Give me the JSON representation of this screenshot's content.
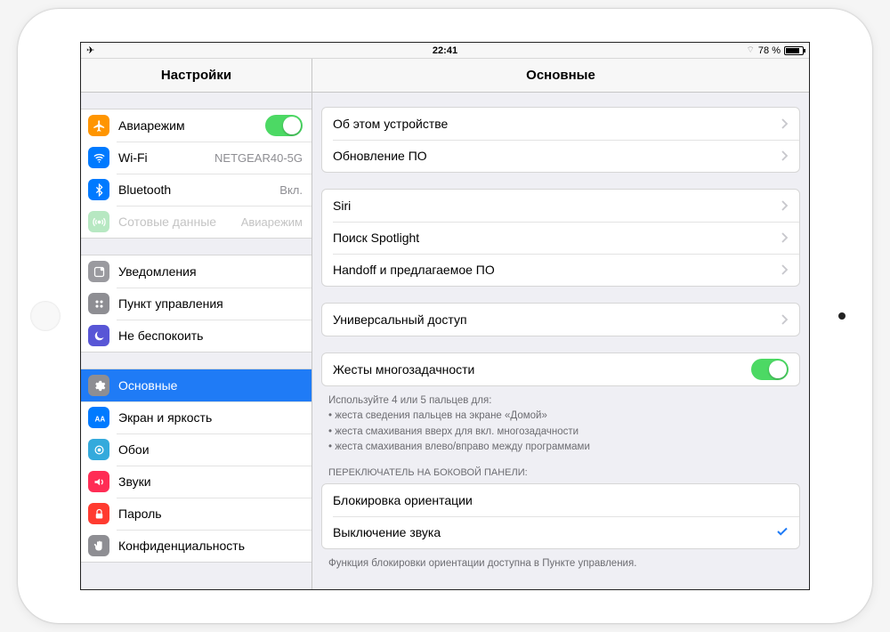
{
  "status": {
    "time": "22:41",
    "battery_text": "78 %",
    "bluetooth_glyph": "⚪"
  },
  "sidebar": {
    "title": "Настройки",
    "groups": [
      {
        "items": [
          {
            "id": "airplane",
            "label": "Авиарежим",
            "toggle": true,
            "icon_color": "#ff9500"
          },
          {
            "id": "wifi",
            "label": "Wi-Fi",
            "value": "NETGEAR40-5G",
            "icon_color": "#007aff"
          },
          {
            "id": "bluetooth",
            "label": "Bluetooth",
            "value": "Вкл.",
            "icon_color": "#007aff"
          },
          {
            "id": "cellular",
            "label": "Сотовые данные",
            "value": "Авиарежим",
            "icon_color": "#4cd964",
            "disabled": true
          }
        ]
      },
      {
        "items": [
          {
            "id": "notifications",
            "label": "Уведомления",
            "icon_color": "#8e8e93"
          },
          {
            "id": "controlcenter",
            "label": "Пункт управления",
            "icon_color": "#8e8e93"
          },
          {
            "id": "dnd",
            "label": "Не беспокоить",
            "icon_color": "#5856d6"
          }
        ]
      },
      {
        "items": [
          {
            "id": "general",
            "label": "Основные",
            "icon_color": "#8e8e93",
            "selected": true
          },
          {
            "id": "display",
            "label": "Экран и яркость",
            "icon_color": "#007aff"
          },
          {
            "id": "wallpaper",
            "label": "Обои",
            "icon_color": "#34aadc"
          },
          {
            "id": "sounds",
            "label": "Звуки",
            "icon_color": "#ff2d55"
          },
          {
            "id": "passcode",
            "label": "Пароль",
            "icon_color": "#ff3b30"
          },
          {
            "id": "privacy",
            "label": "Конфиденциальность",
            "icon_color": "#8e8e93"
          }
        ]
      }
    ]
  },
  "detail": {
    "title": "Основные",
    "group1": {
      "about": "Об этом устройстве",
      "update": "Обновление ПО"
    },
    "group2": {
      "siri": "Siri",
      "spotlight": "Поиск Spotlight",
      "handoff": "Handoff и предлагаемое ПО"
    },
    "group3": {
      "accessibility": "Универсальный доступ"
    },
    "group4": {
      "gestures": "Жесты многозадачности"
    },
    "gestures_hint": "Используйте 4 или 5 пальцев для:\n• жеста сведения пальцев на экране «Домой»\n• жеста смахивания вверх для вкл. многозадачности\n• жеста смахивания влево/вправо между программами",
    "side_switch_caption": "ПЕРЕКЛЮЧАТЕЛЬ НА БОКОВОЙ ПАНЕЛИ:",
    "group5": {
      "lock": "Блокировка ориентации",
      "mute": "Выключение звука"
    },
    "bottom_hint": "Функция блокировки ориентации доступна в Пункте управления."
  }
}
